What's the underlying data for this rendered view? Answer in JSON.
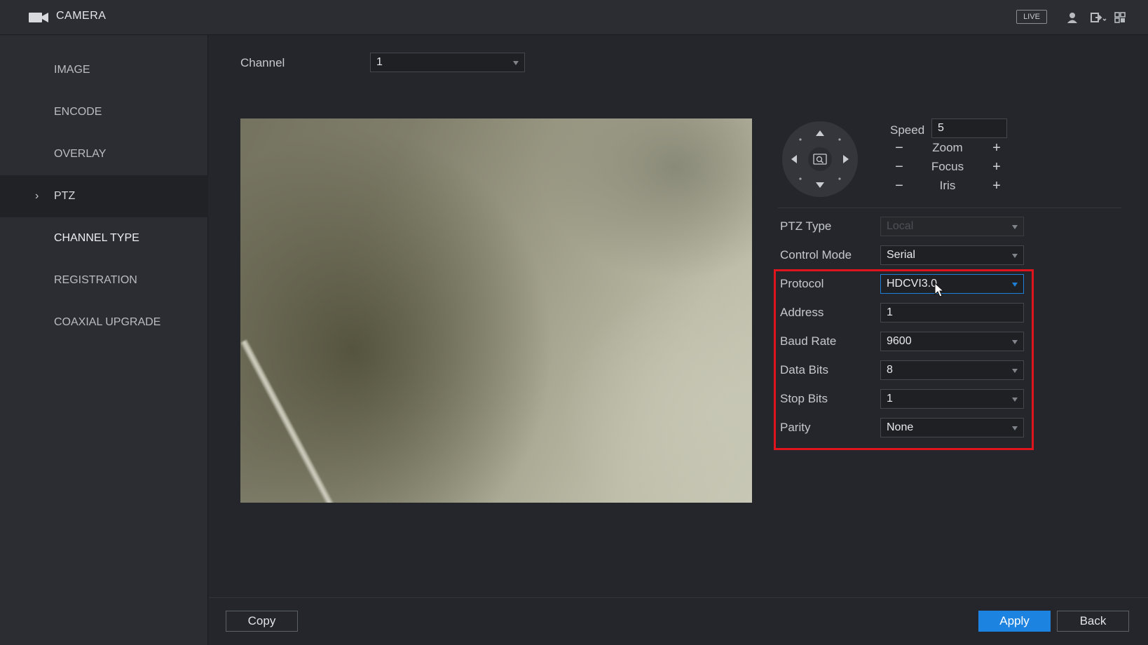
{
  "header": {
    "title": "CAMERA",
    "live_label": "LIVE",
    "icons": [
      "camera-icon",
      "user-icon",
      "logout-icon",
      "grid-icon"
    ]
  },
  "sidebar": {
    "items": [
      {
        "label": "IMAGE"
      },
      {
        "label": "ENCODE"
      },
      {
        "label": "OVERLAY"
      },
      {
        "label": "PTZ",
        "selected": true
      },
      {
        "label": "CHANNEL TYPE"
      },
      {
        "label": "REGISTRATION"
      },
      {
        "label": "COAXIAL UPGRADE"
      }
    ]
  },
  "main": {
    "channel_label": "Channel",
    "channel_value": "1",
    "ptz_control": {
      "speed_label": "Speed",
      "speed_value": "5",
      "zoom_label": "Zoom",
      "focus_label": "Focus",
      "iris_label": "Iris",
      "minus": "−",
      "plus": "+"
    },
    "fields": {
      "ptz_type": {
        "label": "PTZ Type",
        "value": "Local"
      },
      "control_mode": {
        "label": "Control Mode",
        "value": "Serial"
      },
      "protocol": {
        "label": "Protocol",
        "value": "HDCVI3.0"
      },
      "address": {
        "label": "Address",
        "value": "1"
      },
      "baud_rate": {
        "label": "Baud Rate",
        "value": "9600"
      },
      "data_bits": {
        "label": "Data Bits",
        "value": "8"
      },
      "stop_bits": {
        "label": "Stop Bits",
        "value": "1"
      },
      "parity": {
        "label": "Parity",
        "value": "None"
      }
    }
  },
  "footer": {
    "copy_label": "Copy",
    "apply_label": "Apply",
    "back_label": "Back"
  },
  "colors": {
    "accent": "#1d83e0",
    "highlight_box": "#e0141c",
    "background": "#24262b",
    "sidebar": "#2b2d32"
  }
}
